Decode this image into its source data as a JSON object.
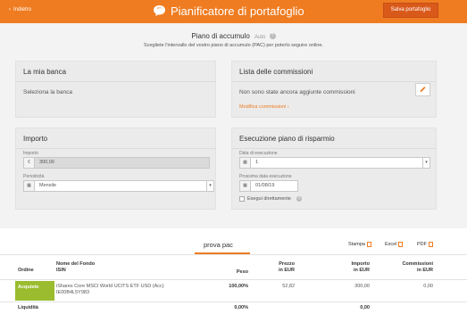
{
  "header": {
    "back_label": "Indietro",
    "title": "Pianificatore di portafoglio",
    "save_label": "Salva portafoglio",
    "accent": "#ef7c21"
  },
  "plan": {
    "title": "Piano di accumulo",
    "auto_label": "Auto",
    "help_icon": "question-icon",
    "subtitle": "Scegliete l'intervallo del vostro piano di accumulo (PAC) per poterlo seguire online."
  },
  "bank": {
    "title": "La mia banca",
    "value": "Seleziona la banca"
  },
  "commissions": {
    "title": "Lista delle commissioni",
    "empty_text": "Non sono state ancora aggiunte commissioni",
    "edit_link": "Modifica commissioni ›"
  },
  "amount": {
    "title": "Importo",
    "importo_label": "Importo",
    "currency_symbol": "€",
    "importo_value": "300,00",
    "period_label": "Periodicità",
    "period_value": "Mensile"
  },
  "execution": {
    "title": "Esecuzione piano di risparmio",
    "day_label": "Dàta di esecuzione",
    "day_value": "1",
    "next_label": "Prossima data esecuzione",
    "next_value": "01/08/19",
    "execute_label": "Esegui direttamente"
  },
  "portfolio": {
    "tab_label": "prova pac",
    "exports": [
      "Stampa",
      "Excel",
      "PDF"
    ],
    "columns": {
      "order": "Ordine",
      "fund_name": "Nome del Fondo",
      "isin": "ISIN",
      "weight": "Peso",
      "price": "Prezzo",
      "price_unit": "in EUR",
      "amount": "Importo",
      "amount_unit": "in EUR",
      "fees": "Commissioni",
      "fees_unit": "in EUR"
    },
    "rows": [
      {
        "order": "Acquisto",
        "fund_name": "iShares Core MSCI World UCITS ETF USD (Acc)",
        "isin": "IE00B4L5Y983",
        "weight": "100,00%",
        "price": "52,82",
        "amount": "300,00",
        "fees": "0,00"
      }
    ],
    "liquidity": {
      "label": "Liquidità",
      "weight": "0,00%",
      "amount": "0,00"
    }
  }
}
